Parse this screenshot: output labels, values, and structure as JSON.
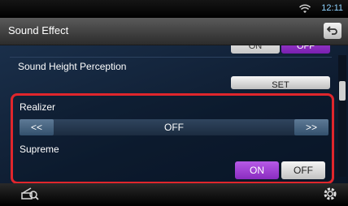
{
  "status": {
    "clock": "12:11"
  },
  "header": {
    "title": "Sound Effect"
  },
  "top_row": {
    "on_label": "ON",
    "off_label": "OFF"
  },
  "sound_height": {
    "label": "Sound Height Perception",
    "button_label": "SET"
  },
  "realizer": {
    "label": "Realizer",
    "prev_label": "<<",
    "value": "OFF",
    "next_label": ">>"
  },
  "supreme": {
    "label": "Supreme",
    "on_label": "ON",
    "off_label": "OFF",
    "selected": "ON"
  },
  "colors": {
    "accent_purple": "#9e3fd0",
    "highlight_red": "#e0262c",
    "clock_blue": "#8fd3ff"
  },
  "icons": [
    "wifi-icon",
    "back-icon",
    "tune-icon",
    "gear-icon"
  ]
}
